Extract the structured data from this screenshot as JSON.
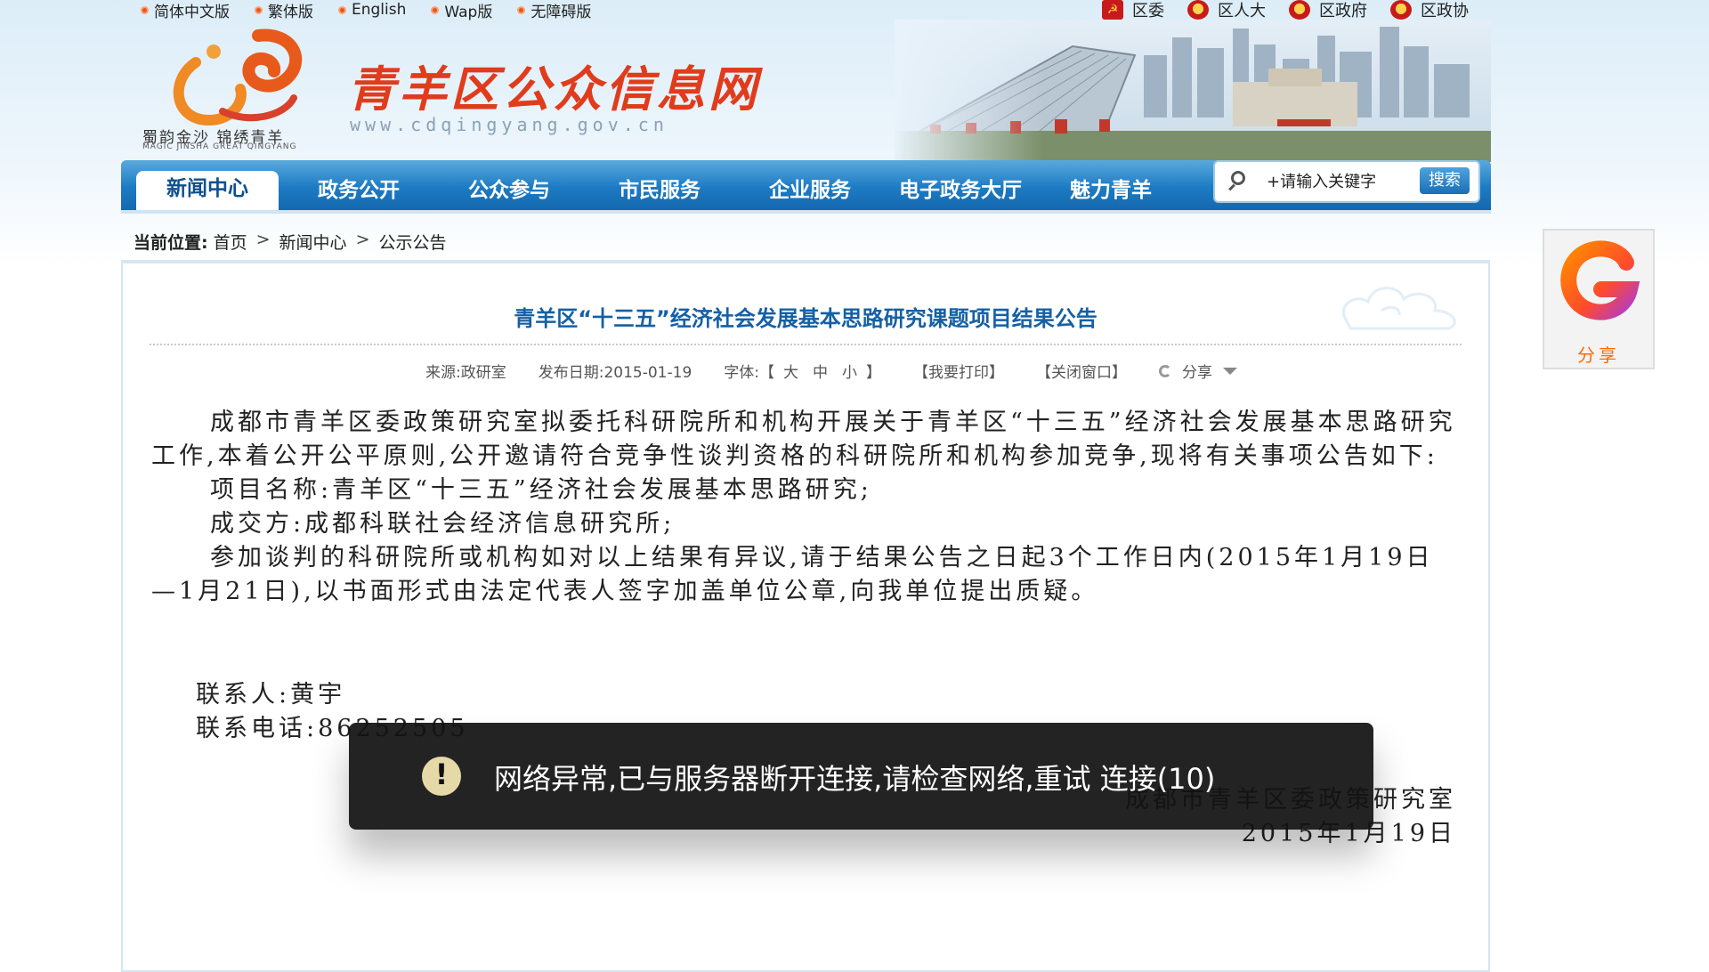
{
  "top_links": [
    "简体中文版",
    "繁体版",
    "English",
    "Wap版",
    "无障碍版"
  ],
  "org_links": [
    "区委",
    "区人大",
    "区政府",
    "区政协"
  ],
  "header": {
    "site_title": "青羊区公众信息网",
    "site_url": "www.cdqingyang.gov.cn",
    "slogan": "蜀韵金沙 锦绣青羊",
    "slogan_en": "MAGIC JINSHA GREAT QINGYANG"
  },
  "nav": {
    "items": [
      "新闻中心",
      "政务公开",
      "公众参与",
      "市民服务",
      "企业服务",
      "电子政务大厅",
      "魅力青羊"
    ],
    "active_index": 0
  },
  "search": {
    "placeholder": "+请输入关键字",
    "button": "搜索"
  },
  "breadcrumb": {
    "label": "当前位置:",
    "items": [
      "首页",
      "新闻中心",
      "公示公告"
    ]
  },
  "article": {
    "title": "青羊区“十三五”经济社会发展基本思路研究课题项目结果公告",
    "meta": {
      "source": "来源:政研室",
      "date": "发布日期:2015-01-19",
      "font_label": "字体:【",
      "font_large": "大",
      "font_medium": "中",
      "font_small": "小",
      "font_end": "】",
      "print": "【我要打印】",
      "close": "【关闭窗口】",
      "share": "分享"
    },
    "paragraphs": [
      "成都市青羊区委政策研究室拟委托科研院所和机构开展关于青羊区“十三五”经济社会发展基本思路研究工作,本着公开公平原则,公开邀请符合竞争性谈判资格的科研院所和机构参加竞争,现将有关事项公告如下:",
      "项目名称:青羊区“十三五”经济社会发展基本思路研究;",
      "成交方:成都科联社会经济信息研究所;",
      "参加谈判的科研院所或机构如对以上结果有异议,请于结果公告之日起3个工作日内(2015年1月19日—1月21日),以书面形式由法定代表人签字加盖单位公章,向我单位提出质疑。"
    ],
    "contact_person": "联系人:黄宇",
    "contact_phone": "联系电话:86252505",
    "signature_org": "成都市青羊区委政策研究室",
    "signature_date": "2015年1月19日"
  },
  "float_share": {
    "label": "分享"
  },
  "toast": {
    "message": "网络异常,已与服务器断开连接,请检查网络,重试 连接(10)",
    "icon": "warning-icon"
  },
  "colors": {
    "nav_blue": "#1c7bc4",
    "title_blue": "#1560a5",
    "brand_red": "#e03c1c",
    "share_orange": "#ff6a00"
  }
}
